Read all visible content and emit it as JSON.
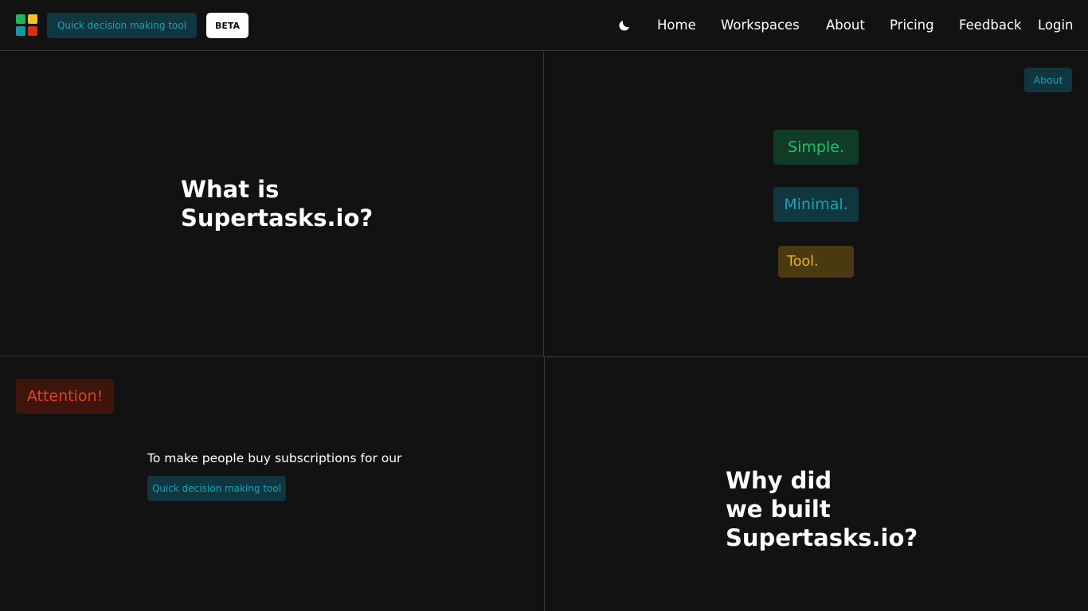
{
  "header": {
    "tagline_chip": "Quick decision making tool",
    "beta_badge": "BETA",
    "theme_icon": "moon-icon",
    "nav": {
      "home": "Home",
      "workspaces": "Workspaces",
      "about": "About",
      "pricing": "Pricing",
      "feedback": "Feedback",
      "login": "Login"
    },
    "logo_colors": [
      "#1fb35a",
      "#f2c12e",
      "#1597a8",
      "#d62f10"
    ]
  },
  "sections": {
    "what_is": {
      "title": "What is\nSupertasks.io?"
    },
    "about_panel": {
      "about_chip": "About",
      "pills": {
        "simple": "Simple.",
        "minimal": "Minimal.",
        "tool": "Tool."
      }
    },
    "attention": {
      "badge": "Attention!",
      "text": "To make people buy subscriptions for our",
      "chip": "Quick decision making tool"
    },
    "why": {
      "title": "Why did\nwe built\nSupertasks.io?"
    }
  },
  "colors": {
    "background": "#121212",
    "chip_bg": "#10363f",
    "chip_text": "#1fa2b8",
    "simple_bg": "#0f3b27",
    "simple_text": "#21c06a",
    "tool_bg": "#4a3a12",
    "tool_text": "#e3b22c",
    "attention_bg": "#3e150d",
    "attention_text": "#e2401c"
  }
}
